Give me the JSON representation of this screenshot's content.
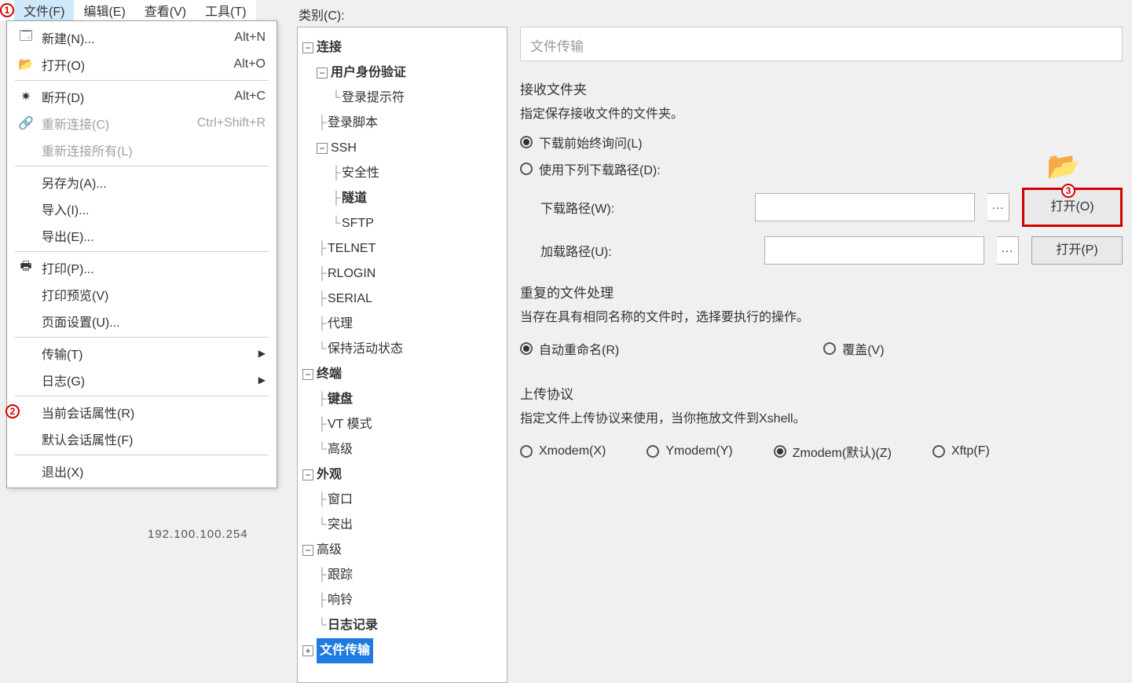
{
  "menubar": {
    "file": "文件(F)",
    "edit": "编辑(E)",
    "view": "查看(V)",
    "tools": "工具(T)"
  },
  "markers": {
    "m1": "1",
    "m2": "2",
    "m3": "3"
  },
  "dropdown": {
    "new": {
      "label": "新建(N)...",
      "shortcut": "Alt+N"
    },
    "open": {
      "label": "打开(O)",
      "shortcut": "Alt+O"
    },
    "disconnect": {
      "label": "断开(D)",
      "shortcut": "Alt+C"
    },
    "reconnect": {
      "label": "重新连接(C)",
      "shortcut": "Ctrl+Shift+R"
    },
    "reconnect_all": {
      "label": "重新连接所有(L)"
    },
    "save_as": {
      "label": "另存为(A)..."
    },
    "import": {
      "label": "导入(I)..."
    },
    "export": {
      "label": "导出(E)..."
    },
    "print": {
      "label": "打印(P)..."
    },
    "print_preview": {
      "label": "打印预览(V)"
    },
    "page_setup": {
      "label": "页面设置(U)..."
    },
    "transfer": {
      "label": "传输(T)"
    },
    "log": {
      "label": "日志(G)"
    },
    "cur_session_props": {
      "label": "当前会话属性(R)"
    },
    "default_session_props": {
      "label": "默认会话属性(F)"
    },
    "exit": {
      "label": "退出(X)"
    }
  },
  "ip_hint": "192.100.100.254",
  "category_label": "类别(C):",
  "tree": {
    "connection": "连接",
    "auth": "用户身份验证",
    "login_prompt": "登录提示符",
    "login_script": "登录脚本",
    "ssh": "SSH",
    "security": "安全性",
    "tunnel": "隧道",
    "sftp": "SFTP",
    "telnet": "TELNET",
    "rlogin": "RLOGIN",
    "serial": "SERIAL",
    "proxy": "代理",
    "keepalive": "保持活动状态",
    "terminal": "终端",
    "keyboard": "键盘",
    "vt_mode": "VT 模式",
    "advanced_term": "高级",
    "appearance": "外观",
    "window": "窗口",
    "highlight": "突出",
    "advanced": "高级",
    "trace": "跟踪",
    "bell": "响铃",
    "logging": "日志记录",
    "file_transfer": "文件传输"
  },
  "settings": {
    "panel_title": "文件传输",
    "recv": {
      "heading": "接收文件夹",
      "desc": "指定保存接收文件的文件夹。",
      "always_ask": "下载前始终询问(L)",
      "use_path": "使用下列下载路径(D):",
      "download_path_label": "下载路径(W):",
      "load_path_label": "加载路径(U):",
      "open_o": "打开(O)",
      "open_p": "打开(P)",
      "dots": "..."
    },
    "dup": {
      "heading": "重复的文件处理",
      "desc": "当存在具有相同名称的文件时，选择要执行的操作。",
      "auto_rename": "自动重命名(R)",
      "overwrite": "覆盖(V)"
    },
    "upload": {
      "heading": "上传协议",
      "desc": "指定文件上传协议来使用，当你拖放文件到Xshell。",
      "xmodem": "Xmodem(X)",
      "ymodem": "Ymodem(Y)",
      "zmodem": "Zmodem(默认)(Z)",
      "xftp": "Xftp(F)"
    }
  }
}
